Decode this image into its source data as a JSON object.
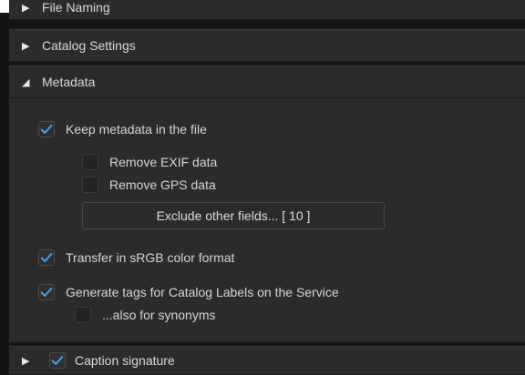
{
  "sections": {
    "file_naming": {
      "label": "File Naming"
    },
    "catalog_settings": {
      "label": "Catalog Settings"
    },
    "metadata": {
      "label": "Metadata"
    },
    "next_section": {
      "label": "Caption signature"
    }
  },
  "metadata": {
    "keep_metadata": {
      "label": "Keep metadata in the file",
      "checked": true
    },
    "remove_exif": {
      "label": "Remove EXIF data",
      "checked": false
    },
    "remove_gps": {
      "label": "Remove GPS data",
      "checked": false
    },
    "exclude_button": {
      "label": "Exclude other fields... [ 10 ]"
    },
    "transfer_srgb": {
      "label": "Transfer in sRGB color format",
      "checked": true
    },
    "generate_tags": {
      "label": "Generate tags for Catalog Labels on the Service",
      "checked": true
    },
    "also_synonyms": {
      "label": "...also for synonyms",
      "checked": false
    }
  },
  "colors": {
    "accent": "#4aa3f0",
    "panel_bg": "#2b2b2b",
    "page_bg": "#141414"
  },
  "icons": {
    "collapsed": "triangle-right-icon",
    "expanded": "triangle-down-icon",
    "check": "checkmark-icon"
  }
}
